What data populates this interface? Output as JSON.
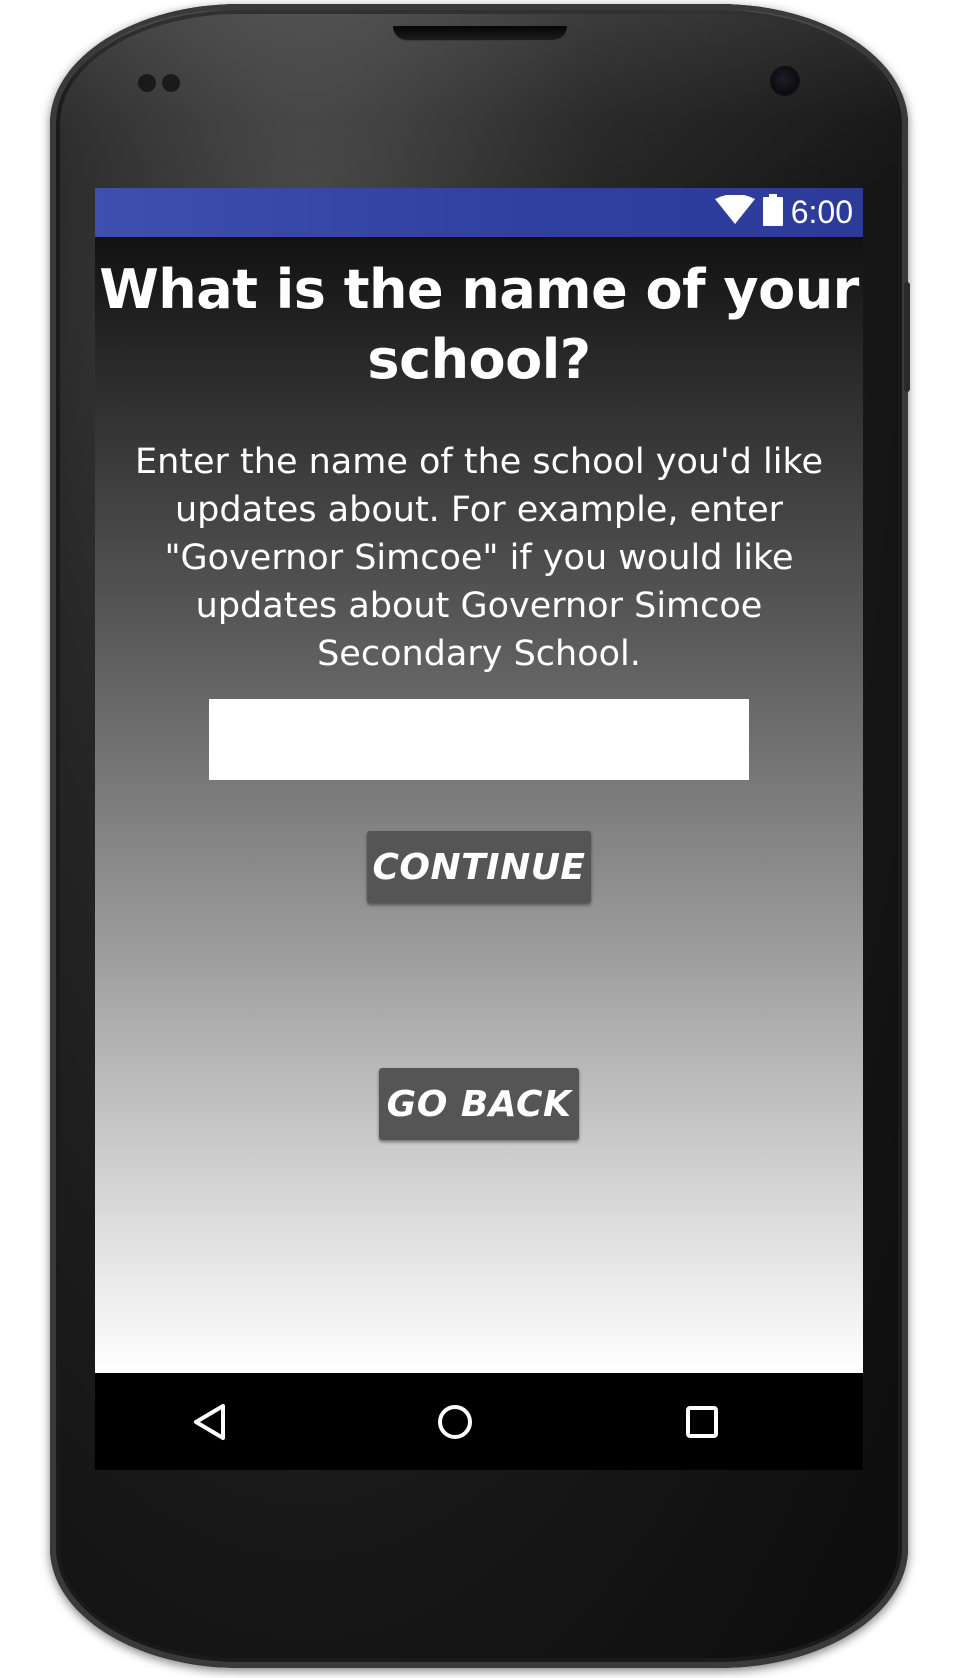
{
  "status_bar": {
    "time": "6:00",
    "icons": [
      "wifi-icon",
      "battery-icon"
    ],
    "color": "#3140a0"
  },
  "screen": {
    "title": "What is the name of your school?",
    "description": "Enter the name of the school you'd like updates about. For example, enter \"Governor Simcoe\" if you would like updates about Governor Simcoe Secondary School.",
    "school_input": {
      "value": "",
      "placeholder": ""
    },
    "continue_label": "CONTINUE",
    "go_back_label": "GO BACK",
    "button_color": "#555555"
  },
  "nav_bar": {
    "icons": [
      "back-icon",
      "home-icon",
      "recents-icon"
    ]
  }
}
